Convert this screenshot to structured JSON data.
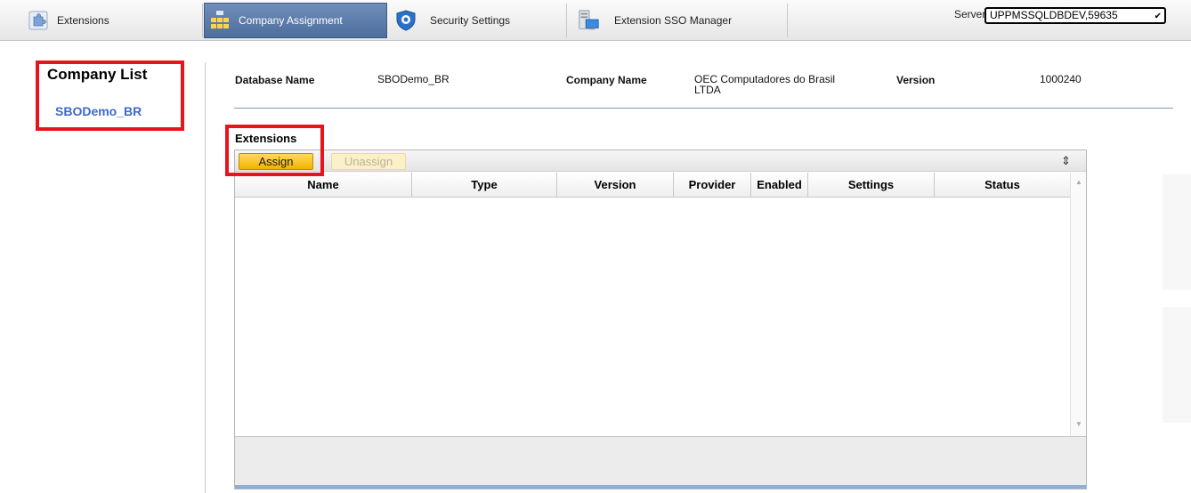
{
  "toolbar": {
    "tabs": [
      {
        "label": "Extensions",
        "icon": "puzzle-icon",
        "active": false
      },
      {
        "label": "Company Assignment",
        "icon": "grid-icon",
        "active": true
      },
      {
        "label": "Security Settings",
        "icon": "shield-icon",
        "active": false
      },
      {
        "label": "Extension SSO Manager",
        "icon": "server-icon",
        "active": false
      }
    ],
    "server_label": "Server",
    "server_value": "UPPMSSQLDBDEV,59635"
  },
  "company_list": {
    "title": "Company List",
    "items": [
      "SBODemo_BR"
    ]
  },
  "company_info": {
    "database_label": "Database Name",
    "database_value": "SBODemo_BR",
    "company_label": "Company Name",
    "company_value_line1": "OEC Computadores do Brasil",
    "company_value_line2": "LTDA",
    "version_label": "Version",
    "version_value": "1000240"
  },
  "extensions": {
    "title": "Extensions",
    "assign_label": "Assign",
    "unassign_label": "Unassign",
    "columns": [
      "Name",
      "Type",
      "Version",
      "Provider",
      "Enabled",
      "Settings",
      "Status"
    ],
    "rows": []
  },
  "colors": {
    "highlight": "#e8141c",
    "link": "#3c6acb",
    "active_tab": "#5a7aa8",
    "assign_button": "#f5bf1a"
  }
}
